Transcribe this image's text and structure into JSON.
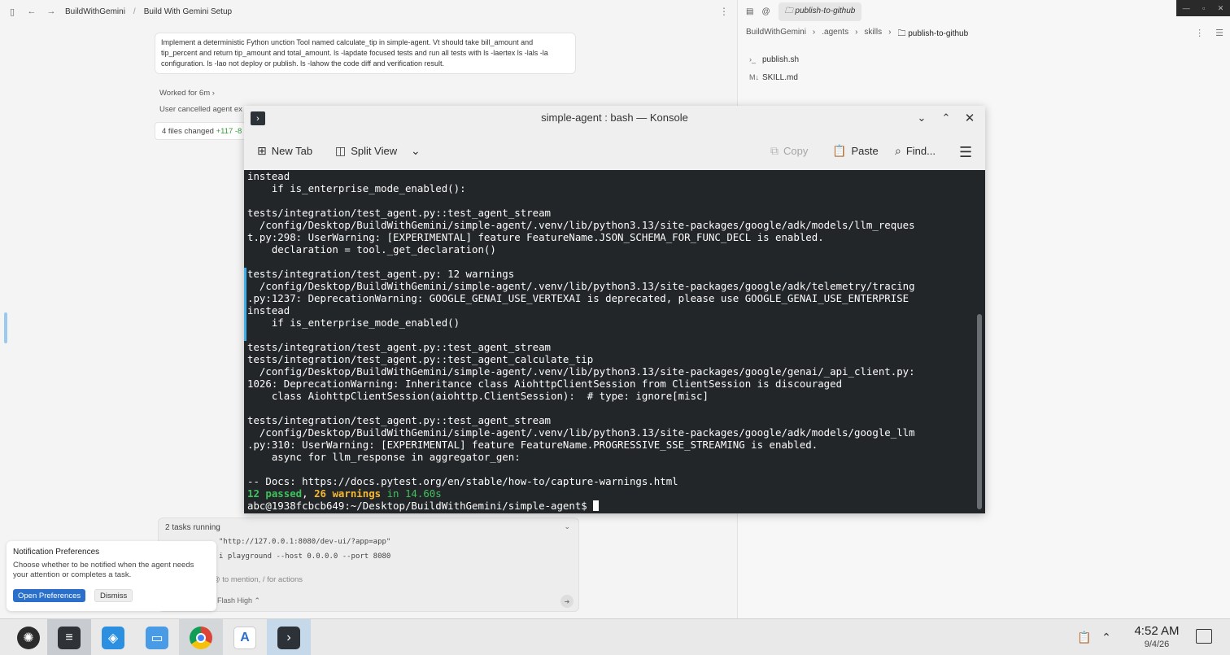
{
  "left_app": {
    "breadcrumb": [
      "BuildWithGemini",
      "Build With Gemini Setup"
    ],
    "breadcrumb_sep": "/",
    "prompt_text": "Implement a deterministic Fython unction Tool named calculate_tip in simple-agent. Vt should take bill_amount and tip_percent and return tip_amount and total_amount. ls -lapdate focused tests and run all tests with ls -laertex ls -lals -la configuration. ls -lao not deploy or publish. ls -lahow the code diff and verification result.",
    "worked_for": "Worked for 6m",
    "cancelled": "User cancelled agent ex",
    "files_changed": "4 files changed",
    "files_plus": "+117 -8"
  },
  "right_pane": {
    "tab_label": "publish-to-github",
    "crumbs": [
      ".agents",
      "skills"
    ],
    "crumb_root": "BuildWithGemini",
    "crumb_current": "publish-to-github",
    "files": [
      "publish.sh",
      "SKILL.md"
    ]
  },
  "tasks": {
    "header": "2 tasks running",
    "line1": "\"http://127.0.0.1:8080/dev-ui/?app=app\"",
    "line2": "i playground --host 0.0.0.0 --port 8080",
    "composer_placeholder": "@ to mention, / for actions",
    "model": "Flash High"
  },
  "notification": {
    "title": "Notification Preferences",
    "body": "Choose whether to be notified when the agent needs your attention or completes a task.",
    "open_label": "Open Preferences",
    "dismiss_label": "Dismiss"
  },
  "konsole": {
    "title": "simple-agent : bash — Konsole",
    "toolbar": {
      "new_tab": "New Tab",
      "split_view": "Split View",
      "copy": "Copy",
      "paste": "Paste",
      "find": "Find..."
    },
    "lines": [
      "instead",
      "    if is_enterprise_mode_enabled():",
      "",
      "tests/integration/test_agent.py::test_agent_stream",
      "  /config/Desktop/BuildWithGemini/simple-agent/.venv/lib/python3.13/site-packages/google/adk/models/llm_reques",
      "t.py:298: UserWarning: [EXPERIMENTAL] feature FeatureName.JSON_SCHEMA_FOR_FUNC_DECL is enabled.",
      "    declaration = tool._get_declaration()",
      "",
      "tests/integration/test_agent.py: 12 warnings",
      "  /config/Desktop/BuildWithGemini/simple-agent/.venv/lib/python3.13/site-packages/google/adk/telemetry/tracing",
      ".py:1237: DeprecationWarning: GOOGLE_GENAI_USE_VERTEXAI is deprecated, please use GOOGLE_GENAI_USE_ENTERPRISE",
      "instead",
      "    if is_enterprise_mode_enabled()",
      "",
      "tests/integration/test_agent.py::test_agent_stream",
      "tests/integration/test_agent.py::test_agent_calculate_tip",
      "  /config/Desktop/BuildWithGemini/simple-agent/.venv/lib/python3.13/site-packages/google/genai/_api_client.py:",
      "1026: DeprecationWarning: Inheritance class AiohttpClientSession from ClientSession is discouraged",
      "    class AiohttpClientSession(aiohttp.ClientSession):  # type: ignore[misc]",
      "",
      "tests/integration/test_agent.py::test_agent_stream",
      "  /config/Desktop/BuildWithGemini/simple-agent/.venv/lib/python3.13/site-packages/google/adk/models/google_llm",
      ".py:310: UserWarning: [EXPERIMENTAL] feature FeatureName.PROGRESSIVE_SSE_STREAMING is enabled.",
      "    async for llm_response in aggregator_gen:",
      "",
      "-- Docs: https://docs.pytest.org/en/stable/how-to/capture-warnings.html"
    ],
    "summary_passed": "12 passed",
    "summary_sep": ", ",
    "summary_warnings": "26 warnings",
    "summary_time": " in 14.60s",
    "prompt": "abc@1938fcbcb649:~/Desktop/BuildWithGemini/simple-agent$ "
  },
  "taskbar": {
    "time": "4:52 AM",
    "date": "9/4/26"
  },
  "icons": [
    "sidebar-toggle-icon",
    "back-icon",
    "forward-icon",
    "kebab-icon",
    "folder-icon",
    "shell-file-icon",
    "markdown-file-icon",
    "terminal-icon",
    "new-tab-icon",
    "split-view-icon",
    "chevron-down-icon",
    "copy-icon",
    "paste-icon",
    "search-icon",
    "hamburger-icon",
    "minimize-icon",
    "maximize-icon",
    "close-icon",
    "launcher-icon",
    "settings-icon",
    "store-icon",
    "files-icon",
    "chrome-icon",
    "android-studio-icon",
    "clipboard-icon",
    "tray-arrow-icon",
    "show-desktop-icon"
  ],
  "colors": {
    "terminal_bg": "#232629",
    "terminal_fg": "#fcfcfc",
    "pass_green": "#3fc25c",
    "warn_yellow": "#f6b833",
    "accent_blue": "#2a6fc9"
  }
}
